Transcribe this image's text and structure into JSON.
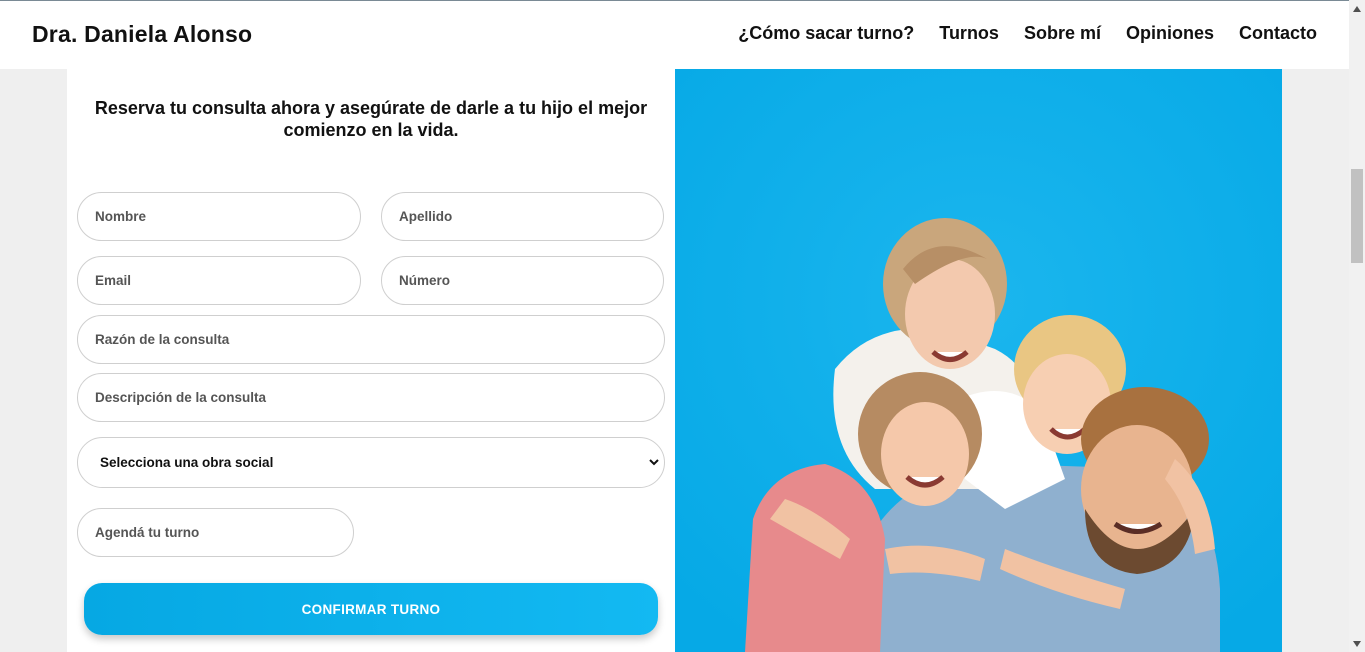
{
  "navbar": {
    "brand": "Dra. Daniela Alonso",
    "links": [
      "¿Cómo sacar turno?",
      "Turnos",
      "Sobre mí",
      "Opiniones",
      "Contacto"
    ]
  },
  "form": {
    "heading": "Reserva tu consulta ahora y asegúrate de darle a tu hijo el mejor comienzo en la vida.",
    "nombre_placeholder": "Nombre",
    "apellido_placeholder": "Apellido",
    "email_placeholder": "Email",
    "numero_placeholder": "Número",
    "razon_placeholder": "Razón de la consulta",
    "descripcion_placeholder": "Descripción de la consulta",
    "obra_social_selected": "Selecciona una obra social",
    "turno_placeholder": "Agendá tu turno",
    "confirm_label": "CONFIRMAR TURNO"
  },
  "colors": {
    "accent": "#06abe9",
    "button": "#0fb2ee"
  },
  "icons": {
    "select": "chevron-down-icon",
    "scroll_up": "arrow-up-icon",
    "scroll_down": "arrow-down-icon"
  }
}
